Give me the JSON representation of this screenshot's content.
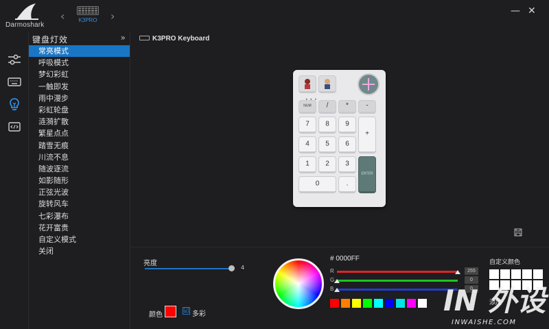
{
  "app": {
    "logo_text": "Darmoshark",
    "device_name": "K3PRO"
  },
  "window": {
    "minimize_glyph": "—",
    "close_glyph": "✕",
    "nav_prev_glyph": "‹",
    "nav_next_glyph": "›"
  },
  "rail": {
    "items": [
      {
        "icon": "sliders-icon",
        "active": false
      },
      {
        "icon": "keyboard-icon",
        "active": false
      },
      {
        "icon": "lightbulb-icon",
        "active": true
      },
      {
        "icon": "code-icon",
        "active": false
      }
    ]
  },
  "effects": {
    "title": "键盘灯效",
    "collapse_glyph": "»",
    "items": [
      "常亮模式",
      "呼吸模式",
      "梦幻彩虹",
      "一触即发",
      "雨中漫步",
      "彩虹轮盘",
      "涟漪扩散",
      "繁星点点",
      "踏雪无痕",
      "川流不息",
      "随波逐流",
      "如影随形",
      "正弦光波",
      "旋转风车",
      "七彩瀑布",
      "花开富贵",
      "自定义模式",
      "关闭"
    ],
    "active_index": 0
  },
  "main": {
    "keyboard_label": "K3PRO Keyboard",
    "keypad": {
      "keys": [
        "NUM",
        "/",
        "*",
        "-",
        "7",
        "8",
        "9",
        "+",
        "4",
        "5",
        "6",
        "1",
        "2",
        "3",
        "ENTER",
        "0",
        "."
      ]
    }
  },
  "panel": {
    "brightness_label": "亮度",
    "brightness_value": "4",
    "brightness_fraction": 0.97,
    "color_label": "颜色",
    "color_value": "#ff0000",
    "multicolor_label": "多彩",
    "multicolor_check_glyph": "☑",
    "hex_label": "# 0000FF",
    "channels": [
      {
        "name": "R",
        "value": "255",
        "color": "#e0242a"
      },
      {
        "name": "G",
        "value": "0",
        "color": "#1fc41f"
      },
      {
        "name": "B",
        "value": "0",
        "color": "#1e3fd1"
      }
    ],
    "presets": [
      "#ff0000",
      "#ff7f00",
      "#ffff00",
      "#00ff00",
      "#00ffff",
      "#0000ff",
      "#00e5e5",
      "#ff00ff",
      "#ffffff"
    ],
    "custom_label": "自定义颜色",
    "add_label": "添加",
    "custom_slots": [
      "#ffffff",
      "#ffffff",
      "#ffffff",
      "#ffffff",
      "#ffffff",
      "#ffffff",
      "#ffffff",
      "#ffffff",
      "#ffffff",
      "#ffffff"
    ]
  },
  "watermark": {
    "logo": "IN 外设",
    "text": "INWAISHE.COM"
  }
}
